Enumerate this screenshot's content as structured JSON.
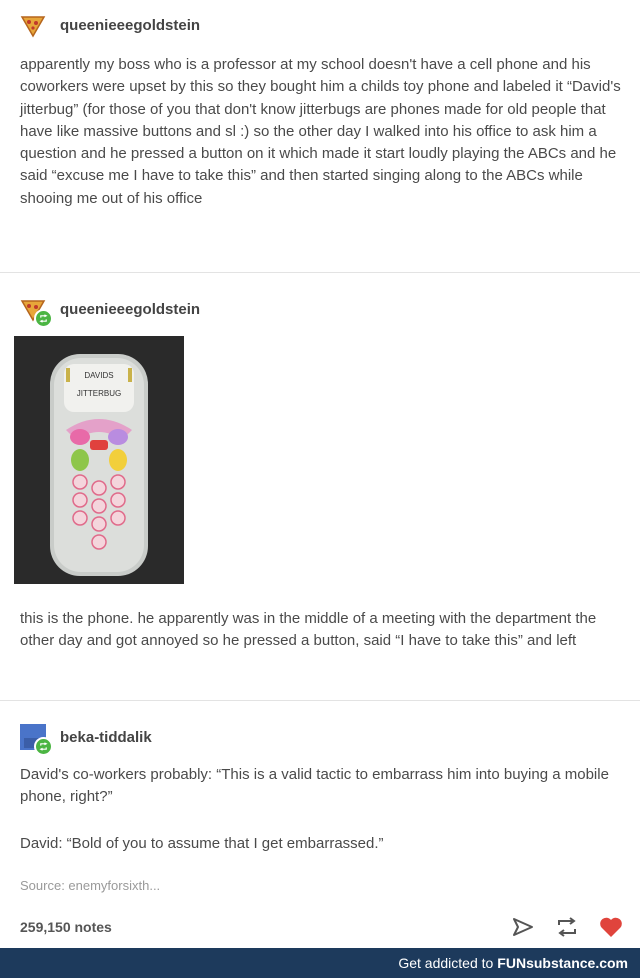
{
  "post1": {
    "username": "queenieeegoldstein",
    "text": "apparently my boss who is a professor at my school doesn't have a cell phone and his coworkers were upset by this so they bought him a childs toy phone and labeled it “David's jitterbug” (for those of you that don't know jitterbugs are phones made for old people that have like massive buttons and sl  :) so the other day I walked into his office to ask him a question and he pressed a button on it which made it start loudly playing the ABCs and he said “excuse me I have to take this” and then started singing along to the ABCs while shooing me out of his office"
  },
  "post2": {
    "username": "queenieeegoldstein",
    "image_label_line1": "DAVIDS",
    "image_label_line2": "JITTERBUG",
    "text": "this is the phone. he apparently was in the middle of a meeting with the department the other day and got annoyed so he pressed a button, said “I have to take this” and left"
  },
  "post3": {
    "username": "beka-tiddalik",
    "text1": "David's co-workers probably: “This is a valid tactic to embarrass him into buying a mobile phone, right?”",
    "text2": "David: “Bold of you to assume that I get embarrassed.”"
  },
  "source": "Source:  enemyforsixth...",
  "notes": "259,150 notes",
  "footer": {
    "prefix": "Get addicted to",
    "brand": "FUNsubstance.com"
  },
  "icons": {
    "avatar1": "pizza-slice-icon",
    "reblog": "reblog-icon",
    "share": "share-arrow-icon",
    "like": "heart-icon"
  },
  "colors": {
    "heart": "#e0443c",
    "footer_bg": "#1d3a5c",
    "reblog_badge": "#4bb543"
  }
}
